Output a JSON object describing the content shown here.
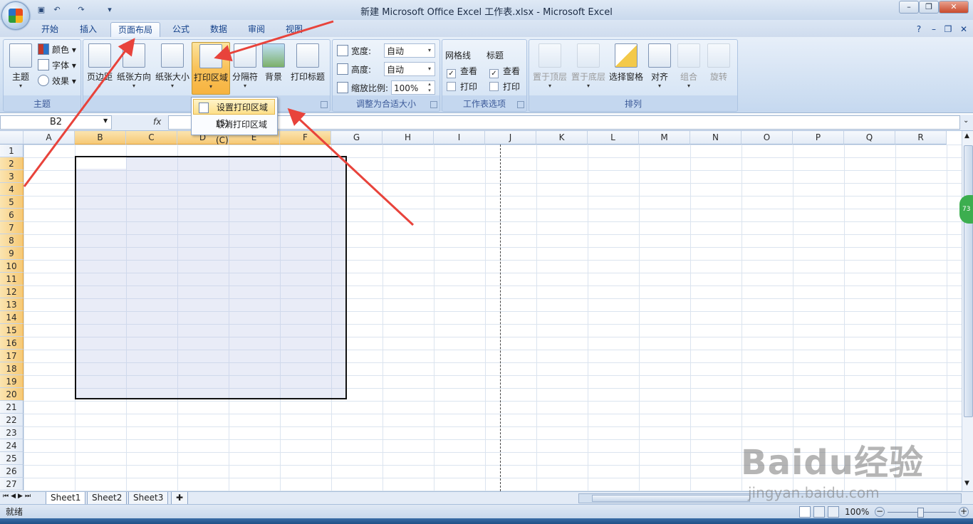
{
  "window": {
    "title": "新建 Microsoft Office Excel 工作表.xlsx - Microsoft Excel"
  },
  "tabs": [
    "开始",
    "插入",
    "页面布局",
    "公式",
    "数据",
    "审阅",
    "视图"
  ],
  "active_tab": "页面布局",
  "ribbon": {
    "themes": {
      "label": "主题",
      "theme_btn": "主题",
      "colors": "颜色",
      "fonts": "字体",
      "effects": "效果"
    },
    "page_setup": {
      "label": "页",
      "margins": "页边距",
      "orientation": "纸张方向",
      "size": "纸张大小",
      "print_area": "打印区域",
      "breaks": "分隔符",
      "background": "背景",
      "print_titles": "打印标题"
    },
    "scale": {
      "label": "调整为合适大小",
      "width_label": "宽度:",
      "width_value": "自动",
      "height_label": "高度:",
      "height_value": "自动",
      "scale_label": "缩放比例:",
      "scale_value": "100%"
    },
    "sheet_options": {
      "label": "工作表选项",
      "gridlines": "网格线",
      "headings": "标题",
      "view": "查看",
      "print": "打印"
    },
    "arrange": {
      "label": "排列",
      "bring_front": "置于顶层",
      "send_back": "置于底层",
      "selection_pane": "选择窗格",
      "align": "对齐",
      "group": "组合",
      "rotate": "旋转"
    }
  },
  "dropdown": {
    "set_print_area": "设置打印区域(S)",
    "clear_print_area": "取消打印区域(C)"
  },
  "formula_bar": {
    "name_box": "B2",
    "fx": "fx",
    "formula": ""
  },
  "grid": {
    "columns": [
      "A",
      "B",
      "C",
      "D",
      "E",
      "F",
      "G",
      "H",
      "I",
      "J",
      "K",
      "L",
      "M",
      "N",
      "O",
      "P",
      "Q",
      "R"
    ],
    "selected_columns": [
      "B",
      "C",
      "D",
      "E",
      "F"
    ],
    "rows": [
      "1",
      "2",
      "3",
      "4",
      "5",
      "6",
      "7",
      "8",
      "9",
      "10",
      "11",
      "12",
      "13",
      "14",
      "15",
      "16",
      "17",
      "18",
      "19",
      "20",
      "21",
      "22",
      "23",
      "24",
      "25",
      "26",
      "27"
    ],
    "selected_rows": [
      "2",
      "3",
      "4",
      "5",
      "6",
      "7",
      "8",
      "9",
      "10",
      "11",
      "12",
      "13",
      "14",
      "15",
      "16",
      "17",
      "18",
      "19",
      "20"
    ]
  },
  "sheets": [
    "Sheet1",
    "Sheet2",
    "Sheet3"
  ],
  "status": {
    "mode": "就绪",
    "zoom": "100%"
  },
  "watermark": {
    "main": "Baidu经验",
    "sub": "jingyan.baidu.com"
  },
  "badge": "73",
  "colors": {
    "ribbon_accent": "#15428b",
    "selection_border": "#111111",
    "arrow": "#e8433b",
    "highlight": "#f9c25a"
  }
}
